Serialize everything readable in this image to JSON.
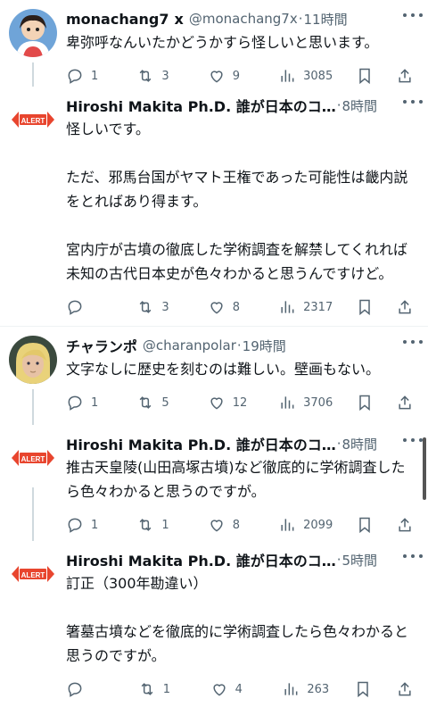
{
  "tweets": [
    {
      "name": "monachang7",
      "badge": "x",
      "handle": "@monachang7x",
      "time": "11時間",
      "text": "卑弥呼なんいたかどうかすら怪しいと思います。",
      "replies": "1",
      "reposts": "3",
      "likes": "9",
      "views": "3085",
      "avatar": "anime-avatar"
    },
    {
      "name": "Hiroshi Makita Ph.D. 誰が日本のコ…",
      "time": "8時間",
      "text": "怪しいです。\n\nただ、邪馬台国がヤマト王権であった可能性は畿内説をとればあり得ます。\n\n宮内庁が古墳の徹底した学術調査を解禁してくれれば未知の古代日本史が色々わかると思うんですけど。",
      "replies": "",
      "reposts": "3",
      "likes": "8",
      "views": "2317",
      "avatar": "alert-logo"
    },
    {
      "name": "チャランポ",
      "handle": "@charanpolar",
      "time": "19時間",
      "text": "文字なしに歴史を刻むのは難しい。壁画もない。",
      "replies": "1",
      "reposts": "5",
      "likes": "12",
      "views": "3706",
      "avatar": "portrait-avatar"
    },
    {
      "name": "Hiroshi Makita Ph.D. 誰が日本のコ…",
      "time": "8時間",
      "text": "推古天皇陵(山田高塚古墳)など徹底的に学術調査したら色々わかると思うのですが。",
      "replies": "1",
      "reposts": "1",
      "likes": "8",
      "views": "2099",
      "avatar": "alert-logo"
    },
    {
      "name": "Hiroshi Makita Ph.D. 誰が日本のコ…",
      "time": "5時間",
      "text": "訂正（300年勘違い）\n\n箸墓古墳などを徹底的に学術調査したら色々わかると思うのですが。",
      "replies": "",
      "reposts": "1",
      "likes": "4",
      "views": "263",
      "avatar": "alert-logo"
    }
  ],
  "logo_text": "ALERT"
}
